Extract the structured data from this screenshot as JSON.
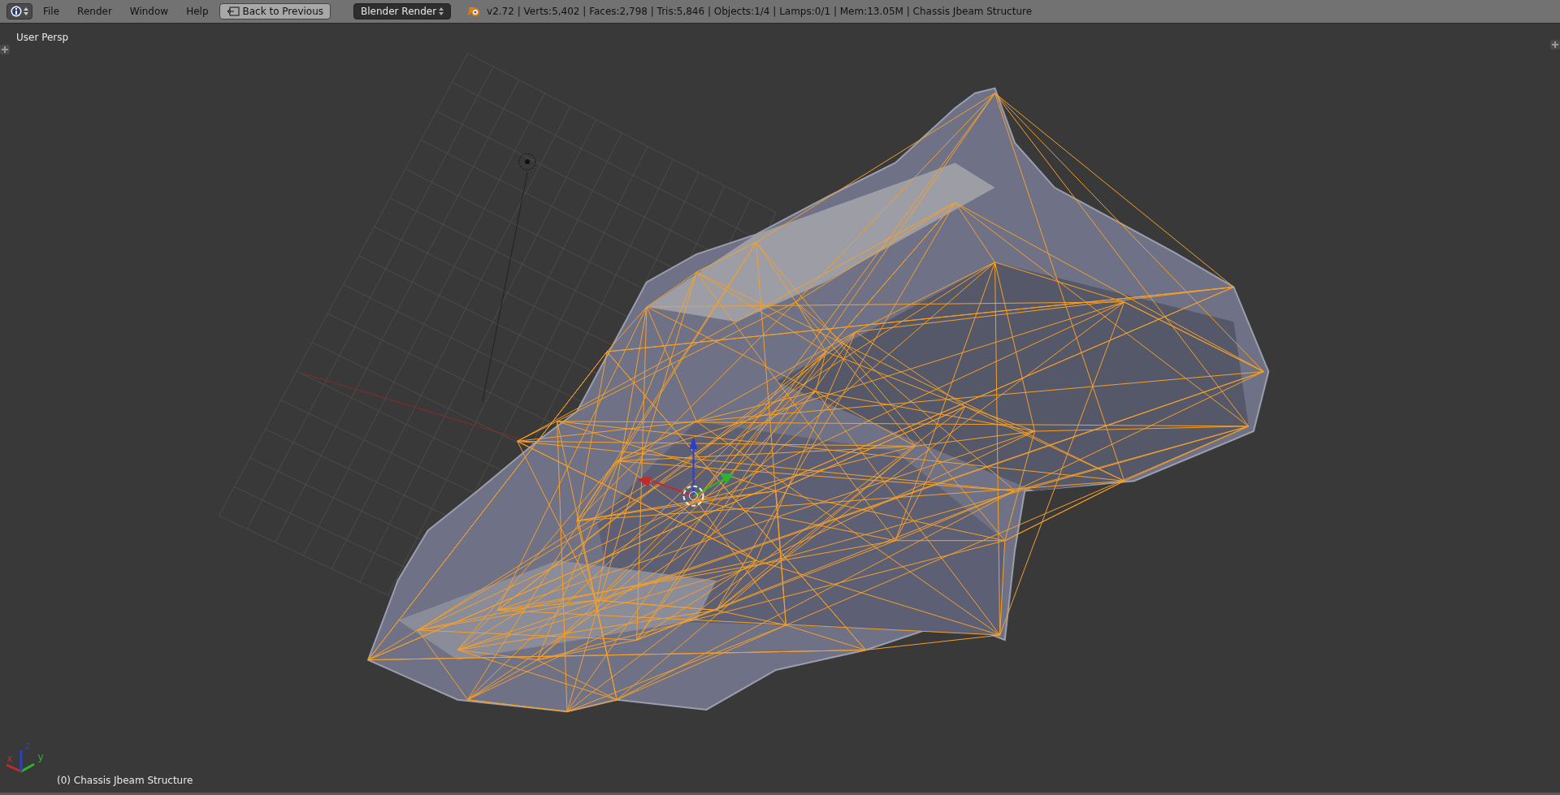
{
  "header": {
    "menus": [
      "File",
      "Render",
      "Window",
      "Help"
    ],
    "back_button": "Back to Previous",
    "render_engine": "Blender Render",
    "stats": "v2.72 | Verts:5,402 | Faces:2,798 | Tris:5,846 | Objects:1/4 | Lamps:0/1 | Mem:13.05M | Chassis Jbeam Structure"
  },
  "viewport": {
    "view_label": "User Persp",
    "object_label": "(0) Chassis Jbeam Structure",
    "axes": [
      {
        "label": "x",
        "color": "#c42a2a"
      },
      {
        "label": "y",
        "color": "#2cb42c"
      },
      {
        "label": "z",
        "color": "#2a3ed0"
      }
    ]
  }
}
